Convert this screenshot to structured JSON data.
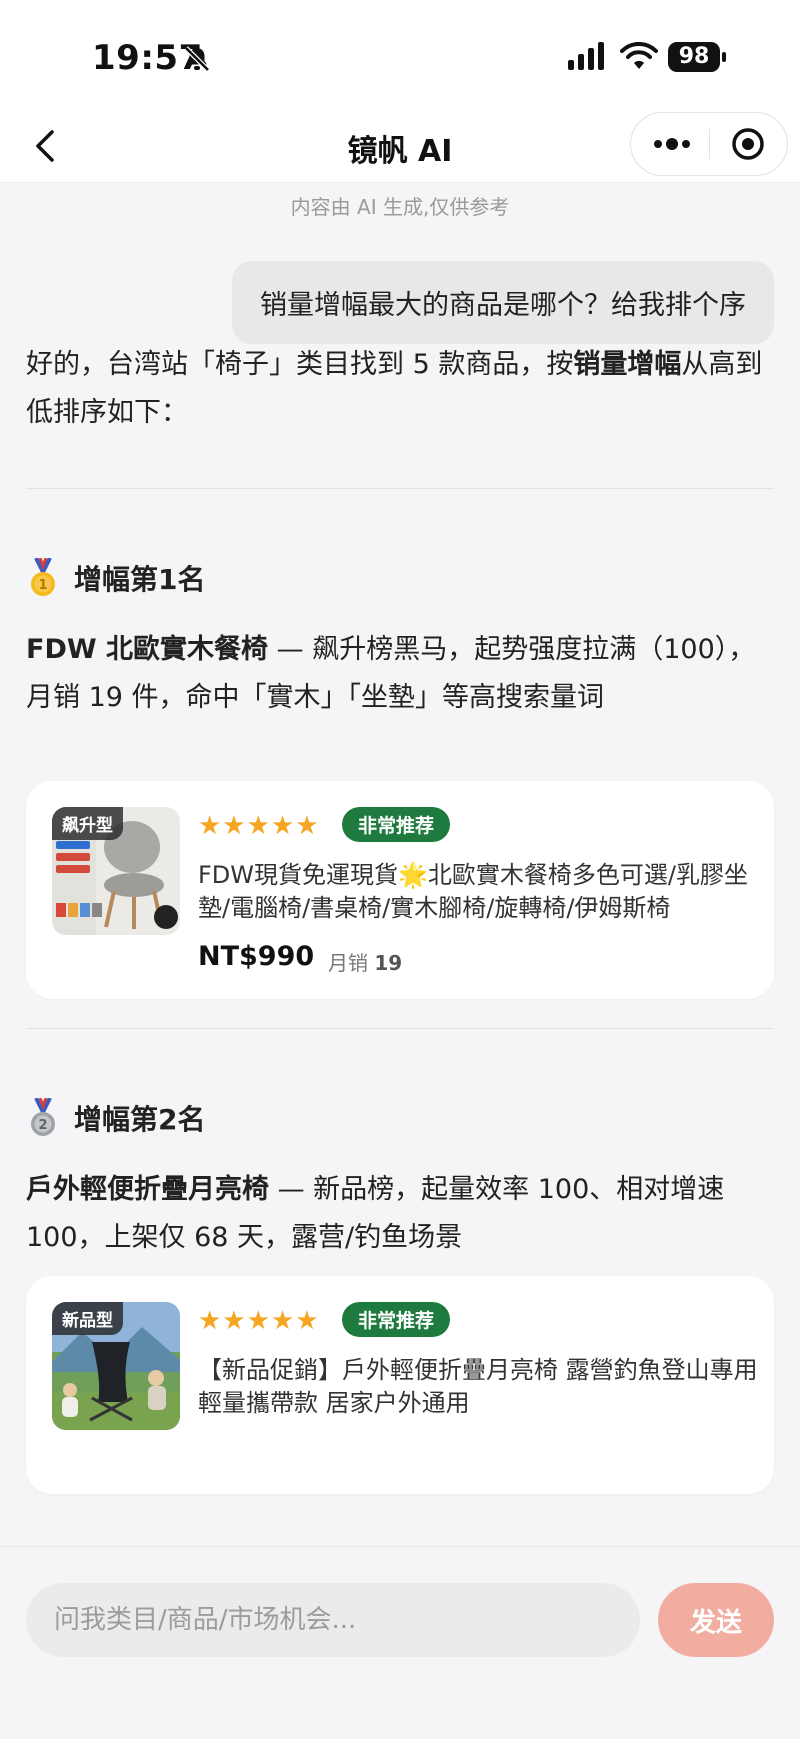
{
  "status_bar": {
    "time": "19:57",
    "battery": "98"
  },
  "nav": {
    "title": "镜帆 AI"
  },
  "chat": {
    "disclaimer": "内容由 AI 生成,仅供参考",
    "user_message": "销量增幅最大的商品是哪个？给我排个序",
    "intro_part1": "好的，台湾站「椅子」类目找到 5 款商品，按",
    "intro_bold": "销量增幅",
    "intro_part2": "从高到低排序如下："
  },
  "ranks": [
    {
      "heading": "增幅第1名",
      "medal": "gold-medal-icon",
      "product_name": "FDW 北歐實木餐椅",
      "desc": " — 飙升榜黑马，起势强度拉满（100），月销 19 件，命中「實木」「坐墊」等高搜索量词",
      "card": {
        "tag": "飙升型",
        "stars": "★★★★★",
        "badge": "非常推荐",
        "title": "FDW現貨免運現貨🌟北歐實木餐椅多色可選/乳膠坐墊/電腦椅/書桌椅/實木腳椅/旋轉椅/伊姆斯椅",
        "price": "NT$990",
        "sales_label": "月销",
        "sales_value": "19"
      }
    },
    {
      "heading": "增幅第2名",
      "medal": "silver-medal-icon",
      "product_name": "戶外輕便折疊月亮椅",
      "desc": " — 新品榜，起量效率 100、相对增速 100，上架仅 68 天，露营/钓鱼场景",
      "card": {
        "tag": "新品型",
        "stars": "★★★★★",
        "badge": "非常推荐",
        "title": "【新品促銷】戶外輕便折疊月亮椅 露營釣魚登山專用 輕量攜帶款 居家户外通用"
      }
    }
  ],
  "input": {
    "placeholder": "问我类目/商品/市场机会...",
    "send_label": "发送"
  },
  "colors": {
    "accent_green": "#1e7a3f",
    "star": "#f5a623",
    "send_button": "#f0ada0"
  }
}
